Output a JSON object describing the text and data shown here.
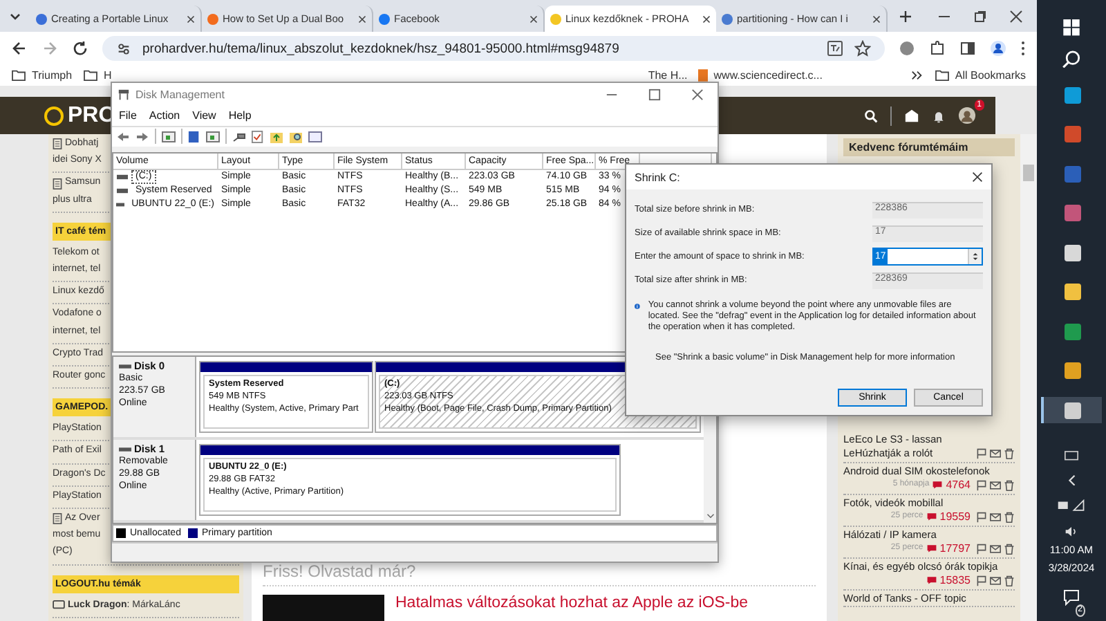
{
  "browser": {
    "tabs": [
      {
        "title": "Creating a Portable Linux",
        "selected": false
      },
      {
        "title": "How to Set Up a Dual Boo",
        "selected": false
      },
      {
        "title": "Facebook",
        "selected": false
      },
      {
        "title": "Linux kezdőknek - PROHA",
        "selected": true
      },
      {
        "title": "partitioning - How can I i",
        "selected": false
      }
    ],
    "url": "prohardver.hu/tema/linux_abszolut_kezdoknek/hsz_94801-95000.html#msg94879",
    "bookmarks": [
      "Triumph",
      "H",
      "The H...",
      "www.sciencedirect.c..."
    ],
    "all_bookmarks": "All Bookmarks"
  },
  "page": {
    "logo": "PRO",
    "notification_count": "1",
    "left_sidebar": [
      {
        "kind": "doc",
        "lines": [
          "Dobhatj",
          "idei Sony X"
        ]
      },
      {
        "kind": "doc",
        "lines": [
          "Samsun",
          "plus ultra"
        ]
      },
      {
        "kind": "header",
        "lines": [
          "IT café tém"
        ]
      },
      {
        "kind": "item",
        "lines": [
          "Telekom ot",
          "internet, tel"
        ]
      },
      {
        "kind": "item",
        "lines": [
          "Linux kezdő"
        ]
      },
      {
        "kind": "item",
        "lines": [
          "Vodafone o",
          "internet, tel"
        ]
      },
      {
        "kind": "item",
        "lines": [
          "Crypto Trad"
        ]
      },
      {
        "kind": "item",
        "lines": [
          "Router gonc"
        ]
      },
      {
        "kind": "header",
        "lines": [
          "GAMEPOD."
        ]
      },
      {
        "kind": "item",
        "lines": [
          "PlayStation"
        ]
      },
      {
        "kind": "item",
        "lines": [
          "Path of Exil"
        ]
      },
      {
        "kind": "item",
        "lines": [
          "Dragon's Dc"
        ]
      },
      {
        "kind": "item",
        "lines": [
          "PlayStation"
        ]
      },
      {
        "kind": "doc",
        "lines": [
          "Az Over",
          "most bemu",
          "(PC)"
        ]
      },
      {
        "kind": "header",
        "lines": [
          "LOGOUT.hu témák"
        ]
      },
      {
        "kind": "user",
        "lines": [
          "**Luck Dragon**: MárkaLánc"
        ]
      }
    ],
    "section_title": "Friss! Olvastad már?",
    "headline": "Hatalmas változásokat hozhat az Apple az iOS-be",
    "favorites": {
      "title": "Kedvenc fórumtémáim",
      "topics": [
        {
          "title": "LeEco Le S3 - lassan",
          "title_2": "LeHúzhatják a rolót"
        },
        {
          "title": "Android dual SIM okostelefonok",
          "age": "5 hónapja",
          "count": "4764"
        },
        {
          "title": "Fotók, videók mobillal",
          "age": "25 perce",
          "count": "19559"
        },
        {
          "title": "Hálózati / IP kamera",
          "age": "25 perce",
          "count": "17797"
        },
        {
          "title": "Kínai, és egyéb olcsó órák topikja",
          "count": "15835"
        },
        {
          "title": "World of Tanks - OFF topic"
        }
      ]
    }
  },
  "disk_management": {
    "title": "Disk Management",
    "menu": [
      "File",
      "Action",
      "View",
      "Help"
    ],
    "columns": [
      "Volume",
      "Layout",
      "Type",
      "File System",
      "Status",
      "Capacity",
      "Free Spa...",
      "% Free"
    ],
    "rows": [
      {
        "cells": [
          "(C:)",
          "Simple",
          "Basic",
          "NTFS",
          "Healthy (B...",
          "223.03 GB",
          "74.10 GB",
          "33 %"
        ],
        "selected": true
      },
      {
        "cells": [
          "System Reserved",
          "Simple",
          "Basic",
          "NTFS",
          "Healthy (S...",
          "549 MB",
          "515 MB",
          "94 %"
        ],
        "selected": false
      },
      {
        "cells": [
          "UBUNTU 22_0 (E:)",
          "Simple",
          "Basic",
          "FAT32",
          "Healthy (A...",
          "29.86 GB",
          "25.18 GB",
          "84 %"
        ],
        "selected": false
      }
    ],
    "disks": [
      {
        "name": "Disk 0",
        "info": [
          "Basic",
          "223.57 GB",
          "Online"
        ],
        "partitions": [
          {
            "name": "System Reserved",
            "size": "549 MB NTFS",
            "status": "Healthy (System, Active, Primary Part",
            "selected": false
          },
          {
            "name": "(C:)",
            "size": "223.03 GB NTFS",
            "status": "Healthy (Boot, Page File, Crash Dump, Primary Partition)",
            "selected": true
          }
        ]
      },
      {
        "name": "Disk 1",
        "info": [
          "Removable",
          "29.88 GB",
          "Online"
        ],
        "partitions": [
          {
            "name": "UBUNTU 22_0  (E:)",
            "size": "29.88 GB FAT32",
            "status": "Healthy (Active, Primary Partition)",
            "selected": false
          }
        ]
      }
    ],
    "legend": [
      {
        "label": "Unallocated",
        "color": "#000000"
      },
      {
        "label": "Primary partition",
        "color": "#000080"
      }
    ]
  },
  "shrink_dialog": {
    "title": "Shrink C:",
    "fields": [
      {
        "label": "Total size before shrink in MB:",
        "value": "228386",
        "kind": "readonly"
      },
      {
        "label": "Size of available shrink space in MB:",
        "value": "17",
        "kind": "readonly"
      },
      {
        "label": "Enter the amount of space to shrink in MB:",
        "value": "17",
        "kind": "spin"
      },
      {
        "label": "Total size after shrink in MB:",
        "value": "228369",
        "kind": "readonly"
      }
    ],
    "info": "You cannot shrink a volume beyond the point where any unmovable files are located. See the \"defrag\" event in the Application log for detailed information about the operation when it has completed.",
    "help": "See \"Shrink a basic volume\" in Disk Management help for more information",
    "buttons": [
      {
        "label": "Shrink",
        "default": true
      },
      {
        "label": "Cancel",
        "default": false
      }
    ]
  },
  "taskbar": {
    "apps": [
      {
        "active": false
      },
      {
        "active": false
      },
      {
        "active": false
      },
      {
        "active": false
      },
      {
        "active": false
      },
      {
        "active": false
      },
      {
        "active": false
      },
      {
        "active": false
      },
      {
        "active": true
      }
    ],
    "time": "11:00 AM",
    "date": "3/28/2024",
    "notifications": "2"
  }
}
